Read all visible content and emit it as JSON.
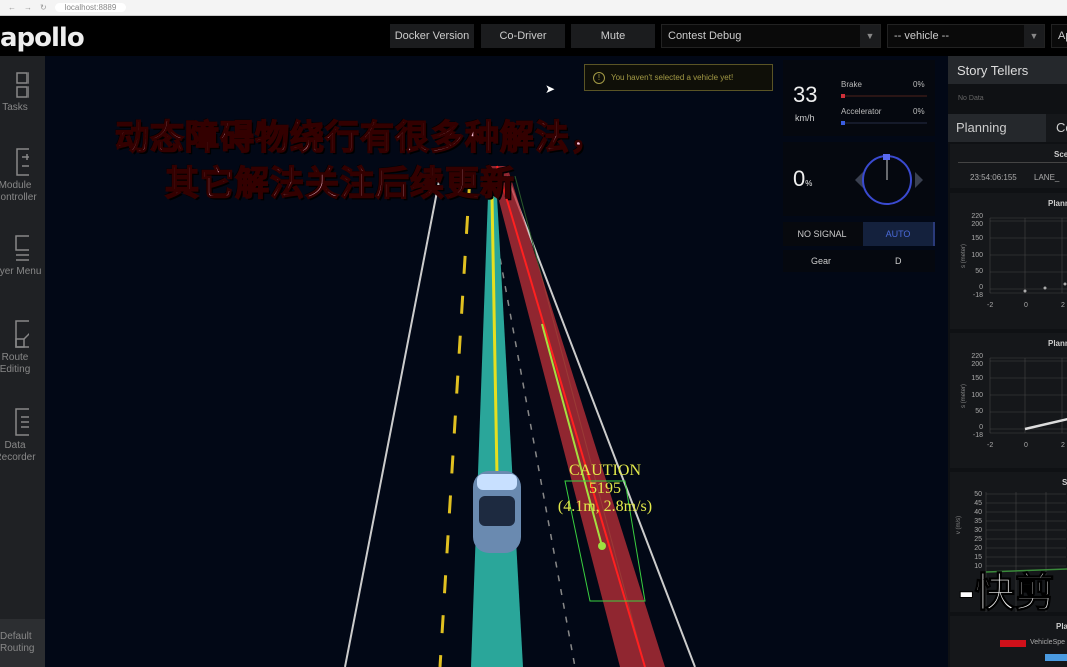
{
  "browser": {
    "url": "localhost:8889"
  },
  "header": {
    "logo": "apollo",
    "buttons": [
      "Docker Version",
      "Co-Driver",
      "Mute"
    ],
    "mode_select": "Contest Debug",
    "vehicle_select": "-- vehicle --",
    "map_select_partial": "Ap"
  },
  "sidebar": {
    "items": [
      {
        "label": "Tasks",
        "icon": "grid-icon"
      },
      {
        "label": "Module Controller",
        "icon": "sliders-icon"
      },
      {
        "label": "Layer Menu",
        "icon": "layers-icon"
      },
      {
        "label": "Route Editing",
        "icon": "route-icon"
      },
      {
        "label": "Data Recorder",
        "icon": "clipboard-icon"
      }
    ],
    "bottom": "Default Routing"
  },
  "scene": {
    "warning": "You haven't selected a vehicle yet!",
    "obstacle": {
      "status": "CAUTION",
      "id": "5195",
      "info": "(4.1m, 2.8m/s)"
    }
  },
  "overlay": {
    "subtitle_line1": "动态障碍物绕行有很多种解法，",
    "subtitle_line2": "其它解法关注后续更新",
    "watermark": "-快剪"
  },
  "dashboard": {
    "speed": "33",
    "speed_unit": "km/h",
    "brake_label": "Brake",
    "brake_value": "0%",
    "accelerator_label": "Accelerator",
    "accelerator_value": "0%",
    "steering": "0",
    "steering_unit": "%",
    "signal": "NO SIGNAL",
    "drive_mode": "AUTO",
    "gear_label": "Gear",
    "gear_value": "D",
    "colors": {
      "brake": "#d0303a",
      "accelerator": "#3a5de0",
      "auto": "#4a6ad8"
    }
  },
  "right_panel": {
    "story_tellers": "Story Tellers",
    "no_data": "No Data",
    "tabs": [
      "Planning",
      "Co"
    ],
    "scenario_title": "Sce",
    "scenario_time": "23:54:06:155",
    "scenario_name": "LANE_",
    "chart1": {
      "title": "Plann",
      "ylabel": "s (meter)",
      "yticks": [
        "220",
        "200",
        "150",
        "100",
        "50",
        "0",
        "-18"
      ],
      "xticks": [
        "-2",
        "0",
        "2"
      ]
    },
    "chart2": {
      "title": "Plann",
      "ylabel": "s (meter)",
      "yticks": [
        "220",
        "200",
        "150",
        "100",
        "50",
        "0",
        "-18"
      ],
      "xticks": [
        "-2",
        "0",
        "2"
      ]
    },
    "chart3": {
      "title": "S",
      "ylabel": "v (m/s)",
      "yticks": [
        "50",
        "45",
        "40",
        "35",
        "30",
        "25",
        "20",
        "15",
        "10"
      ]
    },
    "chart4": {
      "title": "Pla",
      "legend": [
        "VehicleSpe"
      ]
    }
  }
}
